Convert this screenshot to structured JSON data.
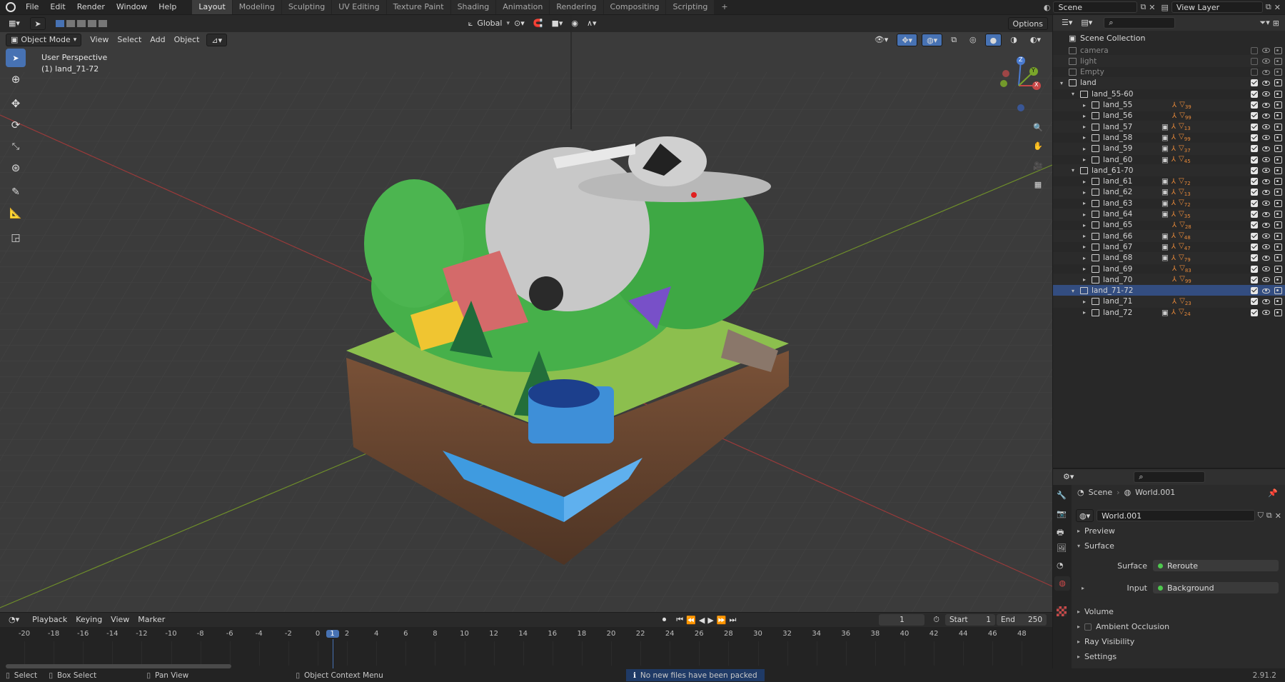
{
  "menubar": {
    "menus": [
      "File",
      "Edit",
      "Render",
      "Window",
      "Help"
    ],
    "workspaces": [
      "Layout",
      "Modeling",
      "Sculpting",
      "UV Editing",
      "Texture Paint",
      "Shading",
      "Animation",
      "Rendering",
      "Compositing",
      "Scripting"
    ],
    "active_workspace": "Layout",
    "add_tab": "+",
    "scene_name": "Scene",
    "view_layer": "View Layer"
  },
  "viewport": {
    "mode": "Object Mode",
    "menus": [
      "View",
      "Select",
      "Add",
      "Object"
    ],
    "orientation": "Global",
    "options": "Options",
    "overlay_title": "User Perspective",
    "overlay_object": "(1) land_71-72",
    "gizmo": {
      "x": "X",
      "y": "Y",
      "z": "Z"
    }
  },
  "outliner": {
    "root": "Scene Collection",
    "rows": [
      {
        "name": "camera",
        "depth": 1,
        "kind": "obj",
        "dim": true,
        "checked": false,
        "mods": []
      },
      {
        "name": "light",
        "depth": 1,
        "kind": "obj",
        "dim": true,
        "checked": false,
        "mods": []
      },
      {
        "name": "Empty",
        "depth": 1,
        "kind": "obj",
        "dim": true,
        "checked": false,
        "mods": []
      },
      {
        "name": "land",
        "depth": 1,
        "kind": "coll",
        "open": true,
        "checked": true,
        "mods": []
      },
      {
        "name": "land_55-60",
        "depth": 2,
        "kind": "coll",
        "open": true,
        "checked": true,
        "mods": []
      },
      {
        "name": "land_55",
        "depth": 3,
        "kind": "coll",
        "checked": true,
        "mods": [
          "39"
        ]
      },
      {
        "name": "land_56",
        "depth": 3,
        "kind": "coll",
        "checked": true,
        "mods": [
          "99"
        ]
      },
      {
        "name": "land_57",
        "depth": 3,
        "kind": "coll",
        "checked": true,
        "mods": [
          "13"
        ],
        "extra": true
      },
      {
        "name": "land_58",
        "depth": 3,
        "kind": "coll",
        "checked": true,
        "mods": [
          "99"
        ],
        "extra": true
      },
      {
        "name": "land_59",
        "depth": 3,
        "kind": "coll",
        "checked": true,
        "mods": [
          "37"
        ],
        "extra": true
      },
      {
        "name": "land_60",
        "depth": 3,
        "kind": "coll",
        "checked": true,
        "mods": [
          "45"
        ],
        "extra": true
      },
      {
        "name": "land_61-70",
        "depth": 2,
        "kind": "coll",
        "open": true,
        "checked": true,
        "mods": []
      },
      {
        "name": "land_61",
        "depth": 3,
        "kind": "coll",
        "checked": true,
        "mods": [
          "72"
        ],
        "extra": true
      },
      {
        "name": "land_62",
        "depth": 3,
        "kind": "coll",
        "checked": true,
        "mods": [
          "13"
        ],
        "extra": true
      },
      {
        "name": "land_63",
        "depth": 3,
        "kind": "coll",
        "checked": true,
        "mods": [
          "72"
        ],
        "extra": true
      },
      {
        "name": "land_64",
        "depth": 3,
        "kind": "coll",
        "checked": true,
        "mods": [
          "35"
        ],
        "extra": true
      },
      {
        "name": "land_65",
        "depth": 3,
        "kind": "coll",
        "checked": true,
        "mods": [
          "28"
        ]
      },
      {
        "name": "land_66",
        "depth": 3,
        "kind": "coll",
        "checked": true,
        "mods": [
          "48"
        ],
        "extra": true
      },
      {
        "name": "land_67",
        "depth": 3,
        "kind": "coll",
        "checked": true,
        "mods": [
          "47"
        ],
        "extra": true
      },
      {
        "name": "land_68",
        "depth": 3,
        "kind": "coll",
        "checked": true,
        "mods": [
          "79"
        ],
        "extra": true
      },
      {
        "name": "land_69",
        "depth": 3,
        "kind": "coll",
        "checked": true,
        "mods": [
          "83"
        ]
      },
      {
        "name": "land_70",
        "depth": 3,
        "kind": "coll",
        "checked": true,
        "mods": [
          "99"
        ]
      },
      {
        "name": "land_71-72",
        "depth": 2,
        "kind": "coll",
        "open": true,
        "checked": true,
        "selected": true,
        "mods": []
      },
      {
        "name": "land_71",
        "depth": 3,
        "kind": "coll",
        "checked": true,
        "mods": [
          "23"
        ]
      },
      {
        "name": "land_72",
        "depth": 3,
        "kind": "coll",
        "checked": true,
        "mods": [
          "24"
        ],
        "extra": true
      }
    ]
  },
  "properties": {
    "breadcrumb_scene": "Scene",
    "breadcrumb_world": "World.001",
    "world_name": "World.001",
    "panels": {
      "preview": "Preview",
      "surface": "Surface",
      "volume": "Volume",
      "ambient_occlusion": "Ambient Occlusion",
      "ray_visibility": "Ray Visibility",
      "settings": "Settings"
    },
    "surface_label": "Surface",
    "surface_value": "Reroute",
    "input_label": "Input",
    "input_value": "Background"
  },
  "timeline": {
    "menus": [
      "Playback",
      "Keying",
      "View",
      "Marker"
    ],
    "current_frame": "1",
    "start_label": "Start",
    "start_value": "1",
    "end_label": "End",
    "end_value": "250",
    "ticks": [
      "-20",
      "-18",
      "-16",
      "-14",
      "-12",
      "-10",
      "-8",
      "-6",
      "-4",
      "-2",
      "0",
      "1",
      "2",
      "4",
      "6",
      "8",
      "10",
      "12",
      "14",
      "16",
      "18",
      "20",
      "22",
      "24",
      "26",
      "28",
      "30",
      "32",
      "34",
      "36",
      "38",
      "40",
      "42",
      "44",
      "46",
      "48"
    ]
  },
  "statusbar": {
    "select": "Select",
    "box_select": "Box Select",
    "pan_view": "Pan View",
    "context_menu": "Object Context Menu",
    "message": "No new files have been packed",
    "version": "2.91.2"
  }
}
